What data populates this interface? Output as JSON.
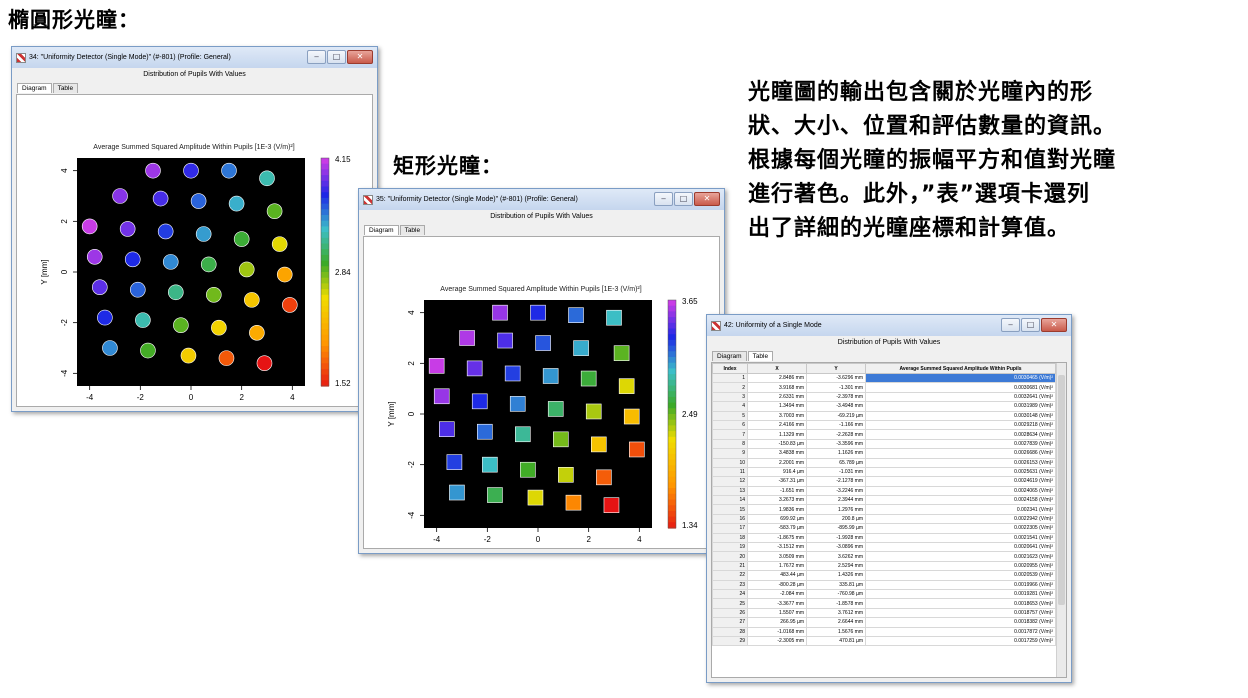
{
  "headings": {
    "ellipse": "橢圓形光瞳：",
    "rect": "矩形光瞳："
  },
  "description": [
    "光瞳圖的輸出包含關於光瞳內的形",
    "狀、大小、位置和評估數量的資訊。",
    "根據每個光瞳的振幅平方和值對光瞳",
    "進行著色。此外，”表”選項卡還列",
    "出了詳細的光瞳座標和計算值。"
  ],
  "window1": {
    "title": "34: \"Uniformity Detector (Single Mode)\" (#-801) (Profile: General)",
    "subtitle": "Distribution of Pupils With Values",
    "tabs": [
      "Diagram",
      "Table"
    ],
    "chart_title": "Average Summed Squared Amplitude Within Pupils  [1E-3 (V/m)²]",
    "xlabel": "X [mm]",
    "ylabel": "Y [mm]"
  },
  "window2": {
    "title": "35: \"Uniformity Detector (Single Mode)\" (#-801) (Profile: General)",
    "subtitle": "Distribution of Pupils With Values",
    "tabs": [
      "Diagram",
      "Table"
    ],
    "chart_title": "Average Summed Squared Amplitude Within Pupils  [1E-3 (V/m)²]",
    "xlabel": "X [mm]",
    "ylabel": "Y [mm]"
  },
  "window3": {
    "title": "42: Uniformity of a Single Mode",
    "subtitle": "Distribution of Pupils With Values",
    "tabs": [
      "Diagram",
      "Table"
    ],
    "columns": [
      "Index",
      "X",
      "Y",
      "Average Summed Squared Amplitude Within Pupils"
    ],
    "rows": [
      [
        "1",
        "2.8486 mm",
        "-3.6296 mm",
        "0.0030465 (V/m)²"
      ],
      [
        "2",
        "3.9168 mm",
        "-1.301 mm",
        "0.0030681 (V/m)²"
      ],
      [
        "3",
        "2.6331 mm",
        "-2.3978 mm",
        "0.0032641 (V/m)²"
      ],
      [
        "4",
        "1.3494 mm",
        "-3.4948 mm",
        "0.0031989 (V/m)²"
      ],
      [
        "5",
        "3.7003 mm",
        "-69.219 µm",
        "0.0030148 (V/m)²"
      ],
      [
        "6",
        "2.4166 mm",
        "-1.166 mm",
        "0.0029218 (V/m)²"
      ],
      [
        "7",
        "1.1329 mm",
        "-2.2628 mm",
        "0.0028634 (V/m)²"
      ],
      [
        "8",
        "-150.83 µm",
        "-3.3596 mm",
        "0.0027839 (V/m)²"
      ],
      [
        "9",
        "3.4838 mm",
        "1.1626 mm",
        "0.0026686 (V/m)²"
      ],
      [
        "10",
        "2.2001 mm",
        "65.789 µm",
        "0.0026153 (V/m)²"
      ],
      [
        "11",
        "916.4 µm",
        "-1.031 mm",
        "0.0025631 (V/m)²"
      ],
      [
        "12",
        "-367.31 µm",
        "-2.1278 mm",
        "0.0024619 (V/m)²"
      ],
      [
        "13",
        "-1.651 mm",
        "-3.2246 mm",
        "0.0024065 (V/m)²"
      ],
      [
        "14",
        "3.2673 mm",
        "2.3944 mm",
        "0.0024158 (V/m)²"
      ],
      [
        "15",
        "1.9836 mm",
        "1.2976 mm",
        "0.002341 (V/m)²"
      ],
      [
        "16",
        "699.92 µm",
        "200.8 µm",
        "0.0022942 (V/m)²"
      ],
      [
        "17",
        "-583.79 µm",
        "-895.99 µm",
        "0.0022305 (V/m)²"
      ],
      [
        "18",
        "-1.8675 mm",
        "-1.9928 mm",
        "0.0021541 (V/m)²"
      ],
      [
        "19",
        "-3.1512 mm",
        "-3.0896 mm",
        "0.0020641 (V/m)²"
      ],
      [
        "20",
        "3.0509 mm",
        "3.6262 mm",
        "0.0021623 (V/m)²"
      ],
      [
        "21",
        "1.7672 mm",
        "2.5294 mm",
        "0.0020955 (V/m)²"
      ],
      [
        "22",
        "483.44 µm",
        "1.4326 mm",
        "0.0020539 (V/m)²"
      ],
      [
        "23",
        "-800.28 µm",
        "335.81 µm",
        "0.0019966 (V/m)²"
      ],
      [
        "24",
        "-2.084 mm",
        "-760.98 µm",
        "0.0019281 (V/m)²"
      ],
      [
        "25",
        "-3.3677 mm",
        "-1.8578 mm",
        "0.0018653 (V/m)²"
      ],
      [
        "26",
        "1.5507 mm",
        "3.7612 mm",
        "0.0018757 (V/m)²"
      ],
      [
        "27",
        "266.95 µm",
        "2.6644 mm",
        "0.0018382 (V/m)²"
      ],
      [
        "28",
        "-1.0168 mm",
        "1.5676 mm",
        "0.0017872 (V/m)²"
      ],
      [
        "29",
        "-2.3005 mm",
        "470.81 µm",
        "0.0017259 (V/m)²"
      ]
    ]
  },
  "chart_data": [
    {
      "type": "scatter",
      "title": "Average Summed Squared Amplitude Within Pupils  [1E-3 (V/m)²]",
      "xlabel": "X [mm]",
      "ylabel": "Y [mm]",
      "xlim": [
        -4.5,
        4.5
      ],
      "ylim": [
        -4.5,
        4.5
      ],
      "xticks": [
        "-4",
        "-2",
        "0",
        "2",
        "4"
      ],
      "yticks": [
        "-4",
        "-2",
        "0",
        "2",
        "4"
      ],
      "marker": "circle",
      "colorbar": {
        "min": 1.52,
        "mid": 2.84,
        "max": 4.15,
        "labels": [
          "1.52",
          "2.84",
          "4.15"
        ]
      },
      "points": [
        {
          "x": -1.5,
          "y": 4.0,
          "v": 4.05
        },
        {
          "x": 0.0,
          "y": 4.0,
          "v": 3.8
        },
        {
          "x": 1.5,
          "y": 4.0,
          "v": 3.55
        },
        {
          "x": 3.0,
          "y": 3.7,
          "v": 3.3
        },
        {
          "x": -2.8,
          "y": 3.0,
          "v": 4.0
        },
        {
          "x": -1.2,
          "y": 2.9,
          "v": 3.85
        },
        {
          "x": 0.3,
          "y": 2.8,
          "v": 3.6
        },
        {
          "x": 1.8,
          "y": 2.7,
          "v": 3.4
        },
        {
          "x": 3.3,
          "y": 2.4,
          "v": 2.9
        },
        {
          "x": -4.0,
          "y": 1.8,
          "v": 4.15
        },
        {
          "x": -2.5,
          "y": 1.7,
          "v": 3.95
        },
        {
          "x": -1.0,
          "y": 1.6,
          "v": 3.7
        },
        {
          "x": 0.5,
          "y": 1.5,
          "v": 3.45
        },
        {
          "x": 2.0,
          "y": 1.3,
          "v": 3.0
        },
        {
          "x": 3.5,
          "y": 1.1,
          "v": 2.6
        },
        {
          "x": -3.8,
          "y": 0.6,
          "v": 4.05
        },
        {
          "x": -2.3,
          "y": 0.5,
          "v": 3.75
        },
        {
          "x": -0.8,
          "y": 0.4,
          "v": 3.5
        },
        {
          "x": 0.7,
          "y": 0.3,
          "v": 3.05
        },
        {
          "x": 2.2,
          "y": 0.1,
          "v": 2.75
        },
        {
          "x": 3.7,
          "y": -0.1,
          "v": 2.15
        },
        {
          "x": -3.6,
          "y": -0.6,
          "v": 3.9
        },
        {
          "x": -2.1,
          "y": -0.7,
          "v": 3.6
        },
        {
          "x": -0.6,
          "y": -0.8,
          "v": 3.2
        },
        {
          "x": 0.9,
          "y": -0.9,
          "v": 2.85
        },
        {
          "x": 2.4,
          "y": -1.1,
          "v": 2.4
        },
        {
          "x": 3.9,
          "y": -1.3,
          "v": 1.7
        },
        {
          "x": -3.4,
          "y": -1.8,
          "v": 3.75
        },
        {
          "x": -1.9,
          "y": -1.9,
          "v": 3.3
        },
        {
          "x": -0.4,
          "y": -2.1,
          "v": 2.9
        },
        {
          "x": 1.1,
          "y": -2.2,
          "v": 2.5
        },
        {
          "x": 2.6,
          "y": -2.4,
          "v": 2.2
        },
        {
          "x": -3.2,
          "y": -3.0,
          "v": 3.5
        },
        {
          "x": -1.7,
          "y": -3.1,
          "v": 2.95
        },
        {
          "x": -0.1,
          "y": -3.3,
          "v": 2.45
        },
        {
          "x": 1.4,
          "y": -3.4,
          "v": 1.8
        },
        {
          "x": 2.9,
          "y": -3.6,
          "v": 1.52
        }
      ]
    },
    {
      "type": "scatter",
      "title": "Average Summed Squared Amplitude Within Pupils  [1E-3 (V/m)²]",
      "xlabel": "X [mm]",
      "ylabel": "Y [mm]",
      "xlim": [
        -4.5,
        4.5
      ],
      "ylim": [
        -4.5,
        4.5
      ],
      "xticks": [
        "-4",
        "-2",
        "0",
        "2",
        "4"
      ],
      "yticks": [
        "-4",
        "-2",
        "0",
        "2",
        "4"
      ],
      "marker": "square",
      "colorbar": {
        "min": 1.34,
        "mid": 2.49,
        "max": 3.65,
        "labels": [
          "1.34",
          "2.49",
          "3.65"
        ]
      },
      "points": [
        {
          "x": -1.5,
          "y": 4.0,
          "v": 3.55
        },
        {
          "x": 0.0,
          "y": 4.0,
          "v": 3.3
        },
        {
          "x": 1.5,
          "y": 3.9,
          "v": 3.15
        },
        {
          "x": 3.0,
          "y": 3.8,
          "v": 2.95
        },
        {
          "x": -2.8,
          "y": 3.0,
          "v": 3.6
        },
        {
          "x": -1.3,
          "y": 2.9,
          "v": 3.4
        },
        {
          "x": 0.2,
          "y": 2.8,
          "v": 3.2
        },
        {
          "x": 1.7,
          "y": 2.6,
          "v": 3.0
        },
        {
          "x": 3.3,
          "y": 2.4,
          "v": 2.55
        },
        {
          "x": -4.0,
          "y": 1.9,
          "v": 3.65
        },
        {
          "x": -2.5,
          "y": 1.8,
          "v": 3.45
        },
        {
          "x": -1.0,
          "y": 1.6,
          "v": 3.25
        },
        {
          "x": 0.5,
          "y": 1.5,
          "v": 3.05
        },
        {
          "x": 2.0,
          "y": 1.4,
          "v": 2.65
        },
        {
          "x": 3.5,
          "y": 1.1,
          "v": 2.3
        },
        {
          "x": -3.8,
          "y": 0.7,
          "v": 3.55
        },
        {
          "x": -2.3,
          "y": 0.5,
          "v": 3.3
        },
        {
          "x": -0.8,
          "y": 0.4,
          "v": 3.1
        },
        {
          "x": 0.7,
          "y": 0.2,
          "v": 2.75
        },
        {
          "x": 2.2,
          "y": 0.1,
          "v": 2.4
        },
        {
          "x": 3.7,
          "y": -0.1,
          "v": 2.05
        },
        {
          "x": -3.6,
          "y": -0.6,
          "v": 3.4
        },
        {
          "x": -2.1,
          "y": -0.7,
          "v": 3.15
        },
        {
          "x": -0.6,
          "y": -0.8,
          "v": 2.85
        },
        {
          "x": 0.9,
          "y": -1.0,
          "v": 2.5
        },
        {
          "x": 2.4,
          "y": -1.2,
          "v": 2.1
        },
        {
          "x": 3.9,
          "y": -1.4,
          "v": 1.55
        },
        {
          "x": -3.3,
          "y": -1.9,
          "v": 3.25
        },
        {
          "x": -1.9,
          "y": -2.0,
          "v": 2.95
        },
        {
          "x": -0.4,
          "y": -2.2,
          "v": 2.6
        },
        {
          "x": 1.1,
          "y": -2.4,
          "v": 2.35
        },
        {
          "x": 2.6,
          "y": -2.5,
          "v": 1.6
        },
        {
          "x": -3.2,
          "y": -3.1,
          "v": 3.05
        },
        {
          "x": -1.7,
          "y": -3.2,
          "v": 2.7
        },
        {
          "x": -0.1,
          "y": -3.3,
          "v": 2.3
        },
        {
          "x": 1.4,
          "y": -3.5,
          "v": 1.75
        },
        {
          "x": 2.9,
          "y": -3.6,
          "v": 1.34
        }
      ]
    }
  ],
  "colors": {
    "plot_background": "#000000",
    "selected_cell": "#3d7ad6",
    "window_border": "#7a9cc6"
  },
  "icons": [
    "minimize-icon",
    "maximize-icon",
    "close-icon",
    "app-icon"
  ]
}
